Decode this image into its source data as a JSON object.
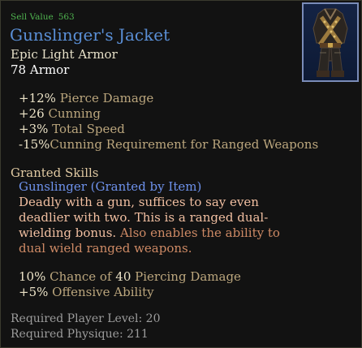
{
  "item": {
    "sell_label": "Sell Value",
    "sell_value": "563",
    "name": "Gunslinger's Jacket",
    "type": "Epic Light Armor",
    "armor": "78 Armor",
    "icon": "jacket-armor-icon"
  },
  "stats": [
    {
      "value": "+12%",
      "label": "Pierce Damage"
    },
    {
      "value": "+26",
      "label": "Cunning"
    },
    {
      "value": "+3%",
      "label": "Total Speed"
    },
    {
      "value": "-15%",
      "label": "Cunning Requirement for Ranged Weapons"
    }
  ],
  "granted": {
    "heading": "Granted Skills",
    "skill_name": "Gunslinger (Granted by Item)",
    "desc_1": "Deadly with a gun, suffices to say even deadlier with two. This is a ranged dual-wielding bonus.",
    "desc_2": "Also enables the ability to dual wield ranged weapons.",
    "effects": [
      {
        "pre_value": "10%",
        "pre_label": "Chance of",
        "value": "40",
        "label": "Piercing Damage"
      },
      {
        "pre_value": "+5%",
        "pre_label": "Offensive Ability",
        "value": "",
        "label": ""
      }
    ]
  },
  "requirements": [
    "Required Player Level: 20",
    "Required Physique: 211"
  ],
  "colors": {
    "sell": "#4fb34f",
    "name": "#5a8fd6",
    "skill": "#6e92ec",
    "desc": "#f1bfa1"
  }
}
